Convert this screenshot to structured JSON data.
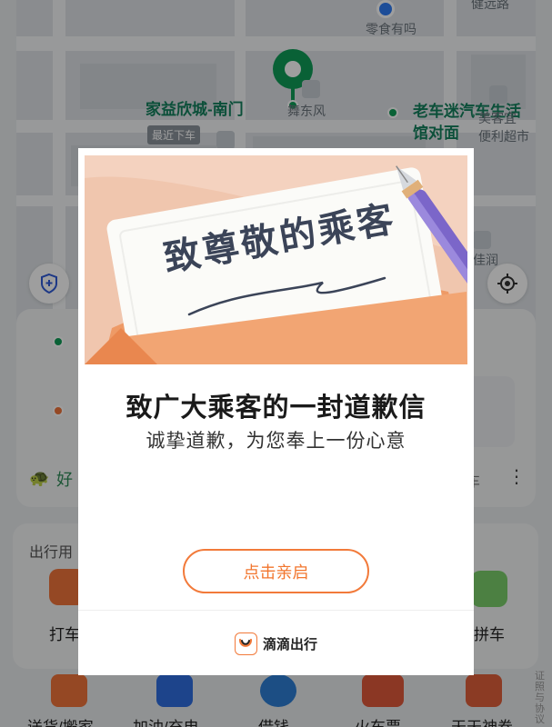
{
  "map": {
    "labels": {
      "snack_shop": "零食有吗",
      "pickup_point": "家益欣城-南门",
      "dance": "舞东风",
      "nearest_dropoff": "最近下车",
      "laoche_line1": "老车迷汽车生活",
      "laoche_line2": "馆对面",
      "convenience_line1": "美客宜",
      "convenience_line2": "便利超市",
      "road_top": "健远路",
      "right_label": "佳润"
    }
  },
  "trip_card": {
    "promo_text": "好",
    "side_text": "车"
  },
  "services": {
    "section_title": "出行用",
    "taxi_label": "打车",
    "carpool_label": "价拼车"
  },
  "bottom_bar": {
    "items": [
      {
        "label": "送货/搬家"
      },
      {
        "label": "加油/充电"
      },
      {
        "label": "借钱"
      },
      {
        "label": "火车票"
      },
      {
        "label": "天天神券"
      }
    ],
    "side_note": "证照与协议"
  },
  "modal": {
    "banner_heading": "致尊敬的乘客",
    "title": "致广大乘客的一封道歉信",
    "subtitle": "诚挚道歉，为您奉上一份心意",
    "open_button": "点击亲启",
    "brand_name": "滴滴出行",
    "brand_logo_icon": "didi-logo-icon"
  },
  "colors": {
    "accent_orange": "#f27a3a",
    "map_green": "#0f9d58",
    "banner_peach": "#f0c6ae"
  }
}
